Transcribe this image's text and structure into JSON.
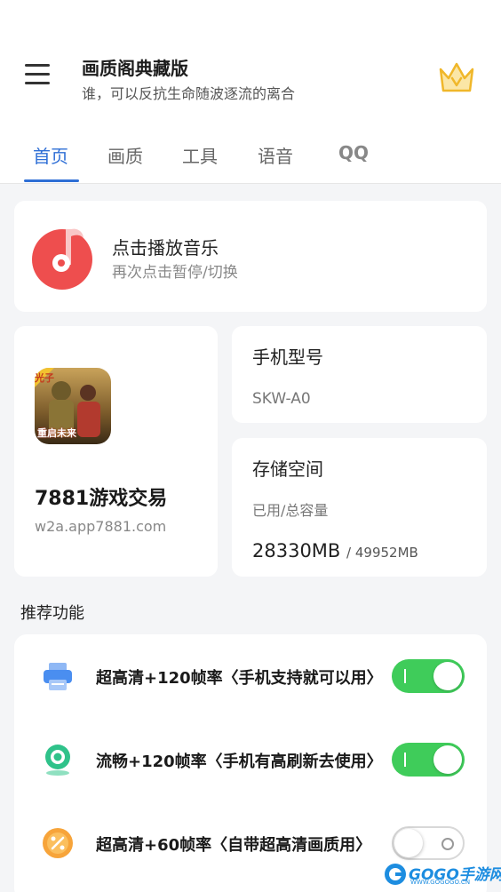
{
  "header": {
    "title": "画质阁典藏版",
    "subtitle": "谁，可以反抗生命随波逐流的离合"
  },
  "tabs": [
    {
      "label": "首页",
      "active": true
    },
    {
      "label": "画质",
      "active": false
    },
    {
      "label": "工具",
      "active": false
    },
    {
      "label": "语音",
      "active": false
    },
    {
      "label": "QQ",
      "active": false
    }
  ],
  "music": {
    "title": "点击播放音乐",
    "subtitle": "再次点击暂停/切换"
  },
  "game": {
    "name": "7881游戏交易",
    "url": "w2a.app7881.com",
    "badge_text": "光子",
    "icon_caption": "重启未来"
  },
  "device": {
    "model_title": "手机型号",
    "model_value": "SKW-A0",
    "storage_title": "存储空间",
    "storage_label": "已用/总容量",
    "used": "28330MB",
    "total": "/ 49952MB"
  },
  "features": {
    "section_title": "推荐功能",
    "items": [
      {
        "label": "超高清+120帧率〈手机支持就可以用〉",
        "enabled": true,
        "icon": "printer-icon"
      },
      {
        "label": "流畅+120帧率〈手机有高刷新去使用〉",
        "enabled": true,
        "icon": "webcam-icon"
      },
      {
        "label": "超高清+60帧率〈自带超高清画质用〉",
        "enabled": false,
        "icon": "percent-icon"
      }
    ]
  },
  "watermark": {
    "text": "GOGO手游网",
    "sub": "WWW.GOGOGO.CN"
  },
  "colors": {
    "accent": "#2f6fd6",
    "toggle_on": "#3fcc5a",
    "music_red": "#ee4e4e"
  }
}
